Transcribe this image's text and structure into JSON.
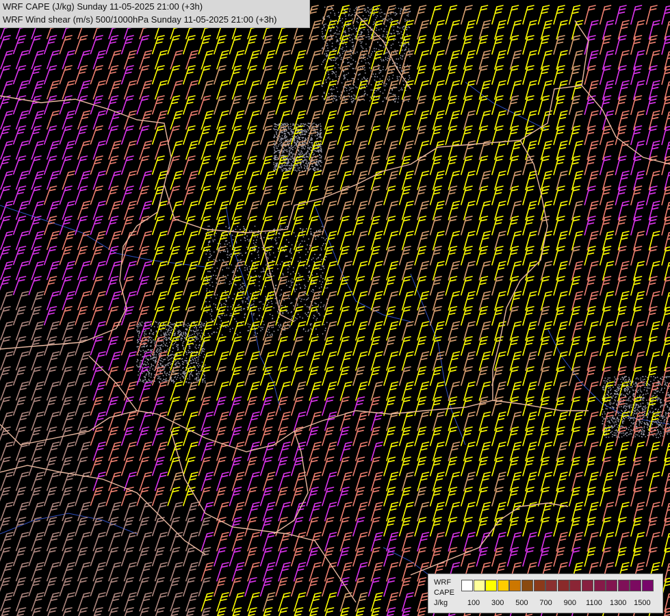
{
  "header": {
    "line1": "WRF CAPE (J/kg) Sunday 11-05-2025 21:00 (+3h)",
    "line2": "WRF Wind shear (m/s) 500/1000hPa Sunday 11-05-2025 21:00 (+3h)"
  },
  "legend": {
    "label_line1": "WRF",
    "label_line2": "CAPE",
    "label_line3": "J/kg",
    "colors": [
      "#ffffff",
      "#ffff99",
      "#ffff00",
      "#ffcc00",
      "#cc7700",
      "#8a4a10",
      "#8b3a1a",
      "#8b3030",
      "#8a2a2a",
      "#8a2535",
      "#882040",
      "#851a48",
      "#821550",
      "#7f1058",
      "#7b0a60",
      "#78066a"
    ],
    "ticks": [
      "100",
      "300",
      "500",
      "700",
      "900",
      "1100",
      "1300",
      "1500"
    ]
  },
  "palette": {
    "background": "#000000",
    "barb_magenta": "#dd33ee",
    "barb_salmon": "#f08070",
    "barb_yellow": "#ffff00",
    "barb_tan": "#d9a070",
    "barb_grey": "#b08880",
    "border": "#e8b8a0",
    "river": "#3050c0"
  }
}
